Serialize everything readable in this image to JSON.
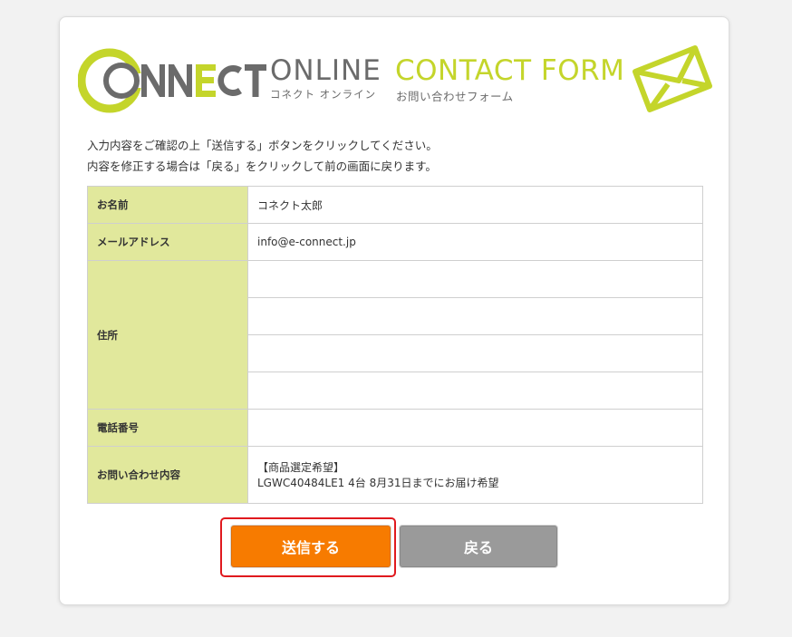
{
  "header": {
    "logo_online": "ONLINE",
    "logo_kana": "コネクト オンライン",
    "title": "CONTACT FORM",
    "subtitle": "お問い合わせフォーム",
    "brand_color": "#c4d52b",
    "logo_text": "CONNECT"
  },
  "instructions": {
    "line1": "入力内容をご確認の上「送信する」ボタンをクリックしてください。",
    "line2": "内容を修正する場合は「戻る」をクリックして前の画面に戻ります。"
  },
  "form": {
    "name_label": "お名前",
    "name_value": "コネクト太郎",
    "email_label": "メールアドレス",
    "email_value": "info@e-connect.jp",
    "address_label": "住所",
    "address_lines": [
      "",
      "",
      "",
      ""
    ],
    "phone_label": "電話番号",
    "phone_value": "",
    "inquiry_label": "お問い合わせ内容",
    "inquiry_line1": "【商品選定希望】",
    "inquiry_line2": "LGWC40484LE1 4台 8月31日までにお届け希望"
  },
  "buttons": {
    "send_label": "送信する",
    "back_label": "戻る",
    "send_color": "#f77b00",
    "back_color": "#9a9a9a",
    "highlight_color": "#e0191e"
  }
}
